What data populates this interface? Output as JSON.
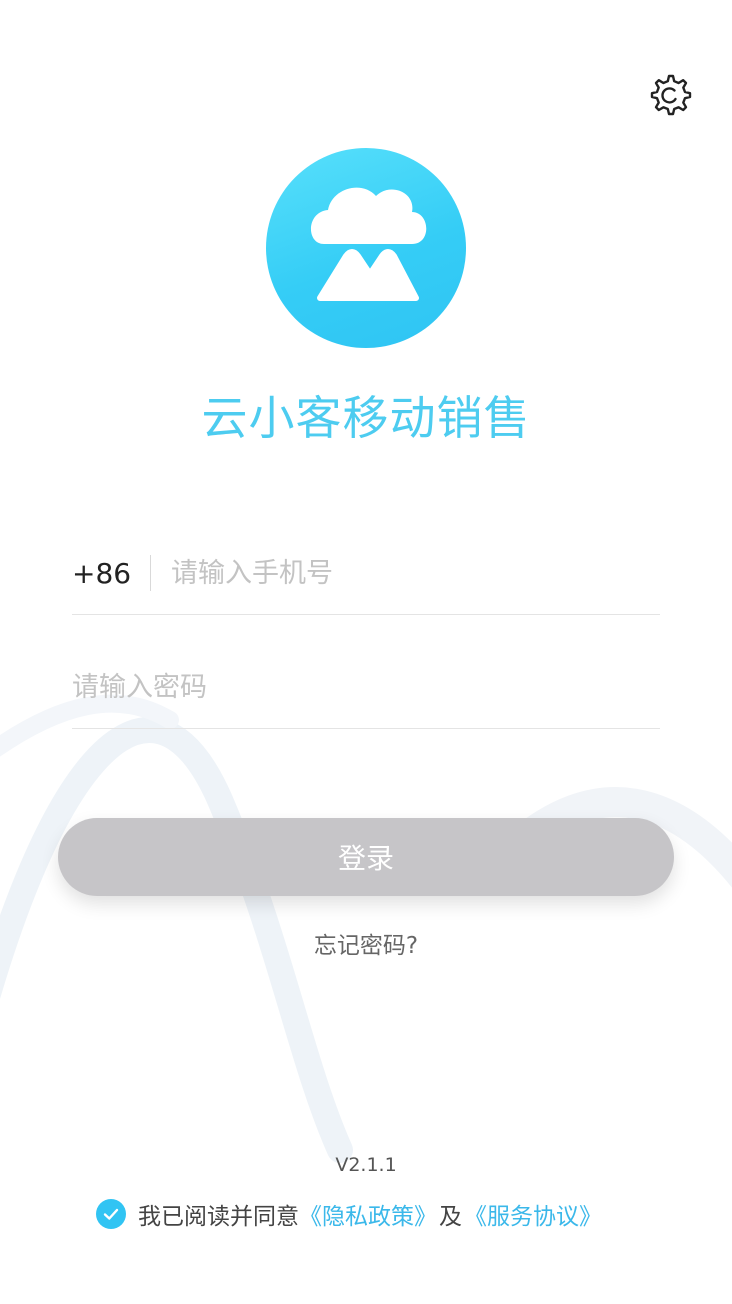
{
  "header": {
    "settings_icon": "gear-icon"
  },
  "logo": {
    "icon": "cloud-mountain-logo",
    "gradient_start": "#58e0fb",
    "gradient_end": "#2fc4f3"
  },
  "app": {
    "title": "云小客移动销售",
    "title_color": "#4dccf0"
  },
  "login_form": {
    "country_code": "+86",
    "phone_placeholder": "请输入手机号",
    "phone_value": "",
    "password_placeholder": "请输入密码",
    "password_value": "",
    "submit_label": "登录",
    "forgot_label": "忘记密码?"
  },
  "footer": {
    "version": "V2.1.1",
    "agree_checked": true,
    "agree_prefix": "我已阅读并同意",
    "privacy_link": "《隐私政策》",
    "and_text": "及",
    "terms_link": "《服务协议》",
    "link_color": "#3bb8ea"
  }
}
